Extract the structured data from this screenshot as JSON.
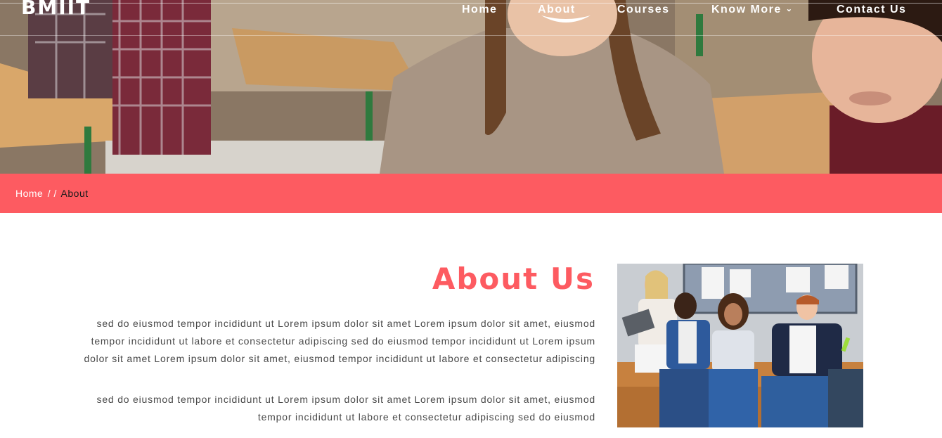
{
  "brand": {
    "logo_text": "BMIIT"
  },
  "nav": {
    "items": [
      {
        "label": "Home"
      },
      {
        "label": "About"
      },
      {
        "label": "Courses"
      },
      {
        "label": "Know More",
        "has_dropdown": true
      },
      {
        "label": "Contact Us"
      }
    ]
  },
  "breadcrumb": {
    "home": "Home",
    "separator": "/ /",
    "current": "About"
  },
  "about": {
    "title": "About Us",
    "paragraphs": [
      "sed do eiusmod tempor incididunt ut Lorem ipsum dolor sit amet Lorem ipsum dolor sit amet, eiusmod tempor incididunt ut labore et consectetur adipiscing sed do eiusmod tempor incididunt ut Lorem ipsum dolor sit amet Lorem ipsum dolor sit amet, eiusmod tempor incididunt ut labore et consectetur adipiscing",
      "sed do eiusmod tempor incididunt ut Lorem ipsum dolor sit amet Lorem ipsum dolor sit amet, eiusmod tempor incididunt ut labore et consectetur adipiscing sed do eiusmod"
    ]
  },
  "colors": {
    "accent": "#fd5b61",
    "text": "#4a4a4a",
    "nav_text": "#ffffff"
  },
  "icons": {
    "dropdown": "chevron-down-icon"
  }
}
